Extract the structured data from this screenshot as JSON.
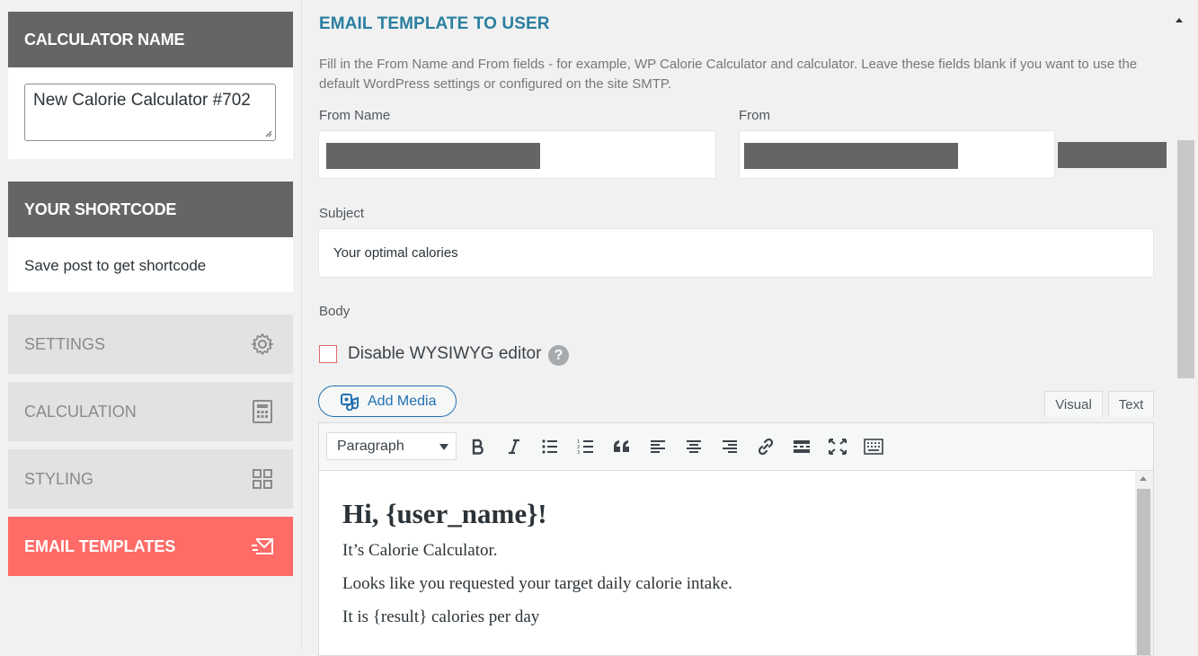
{
  "sidebar": {
    "calculator_name_header": "CALCULATOR NAME",
    "calculator_name_value": "New Calorie Calculator #702",
    "shortcode_header": "YOUR SHORTCODE",
    "shortcode_text": "Save post to get shortcode",
    "menu": [
      {
        "label": "SETTINGS",
        "icon": "gear-icon",
        "active": false
      },
      {
        "label": "CALCULATION",
        "icon": "calculator-icon",
        "active": false
      },
      {
        "label": "STYLING",
        "icon": "grid-icon",
        "active": false
      },
      {
        "label": "EMAIL TEMPLATES",
        "icon": "email-icon",
        "active": true
      }
    ]
  },
  "main": {
    "section_title": "EMAIL TEMPLATE TO USER",
    "description": "Fill in the From Name and From fields - for example, WP Calorie Calculator and calculator. Leave these fields blank if you want to use the default WordPress settings or configured on the site SMTP.",
    "from_name_label": "From Name",
    "from_label": "From",
    "subject_label": "Subject",
    "subject_value": "Your optimal calories",
    "body_label": "Body",
    "disable_wysiwyg_label": "Disable WYSIWYG editor",
    "help_glyph": "?",
    "add_media_label": "Add Media",
    "tabs": {
      "visual": "Visual",
      "text": "Text"
    },
    "format_select": "Paragraph",
    "toolbar_icons": [
      "bold-icon",
      "italic-icon",
      "bullet-list-icon",
      "numbered-list-icon",
      "blockquote-icon",
      "align-left-icon",
      "align-center-icon",
      "align-right-icon",
      "link-icon",
      "read-more-icon",
      "fullscreen-icon",
      "toolbar-toggle-icon"
    ],
    "body_content": {
      "heading": "Hi, {user_name}!",
      "line1": "It’s Calorie Calculator.",
      "line2": "Looks like you requested your target daily calorie intake.",
      "line3": "It is {result} calories per day"
    }
  },
  "colors": {
    "sidebar_header": "#646567",
    "active_menu": "#ff6b66",
    "section_title": "#2a7fa0",
    "link_blue": "#2271b1"
  }
}
